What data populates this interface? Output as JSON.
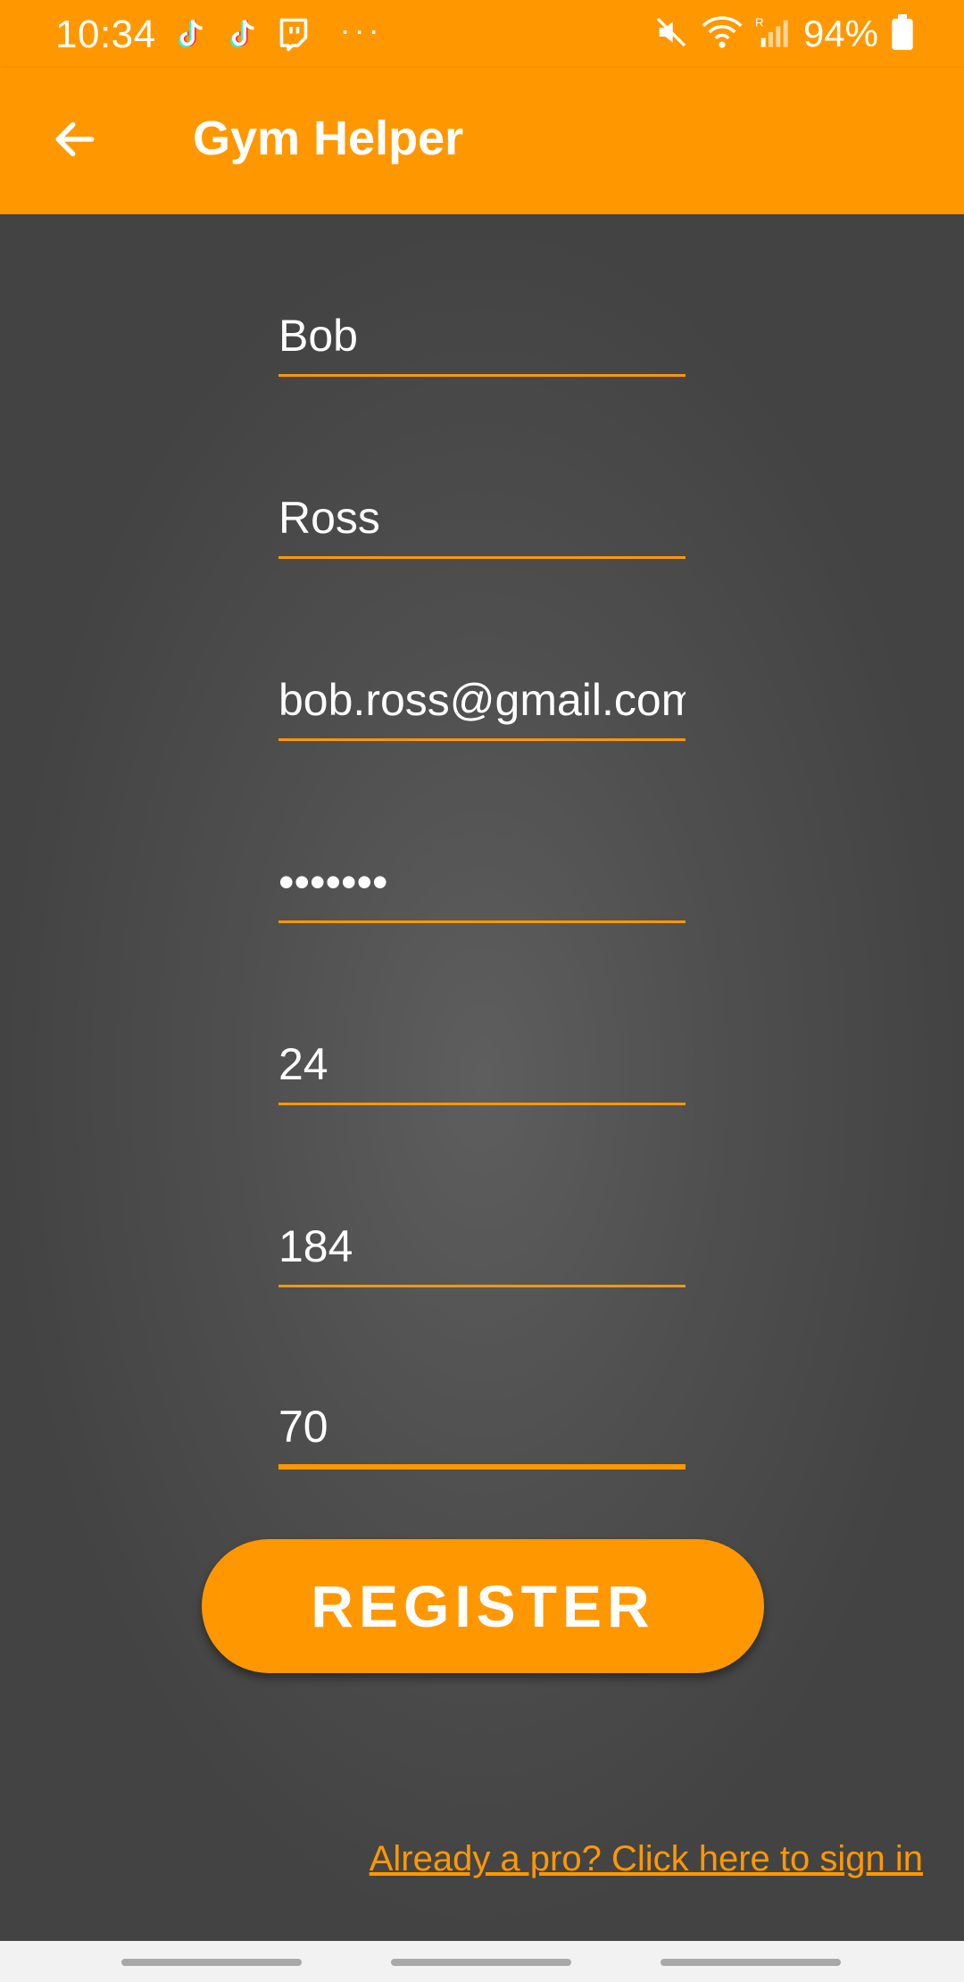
{
  "status_bar": {
    "time": "10:34",
    "notification_icons": [
      "tiktok-icon",
      "tiktok-icon",
      "twitch-icon"
    ],
    "more": "···",
    "battery": "94%"
  },
  "app_bar": {
    "title": "Gym Helper"
  },
  "form": {
    "first_name": "Bob",
    "last_name": "Ross",
    "email": "bob.ross@gmail.com",
    "password": "•••••••",
    "age": "24",
    "height": "184",
    "weight": "70"
  },
  "register_label": "REGISTER",
  "signin_link": "Already a pro? Click here to sign in",
  "colors": {
    "accent": "#ff9800",
    "background": "#444444",
    "text": "#ffffff"
  }
}
